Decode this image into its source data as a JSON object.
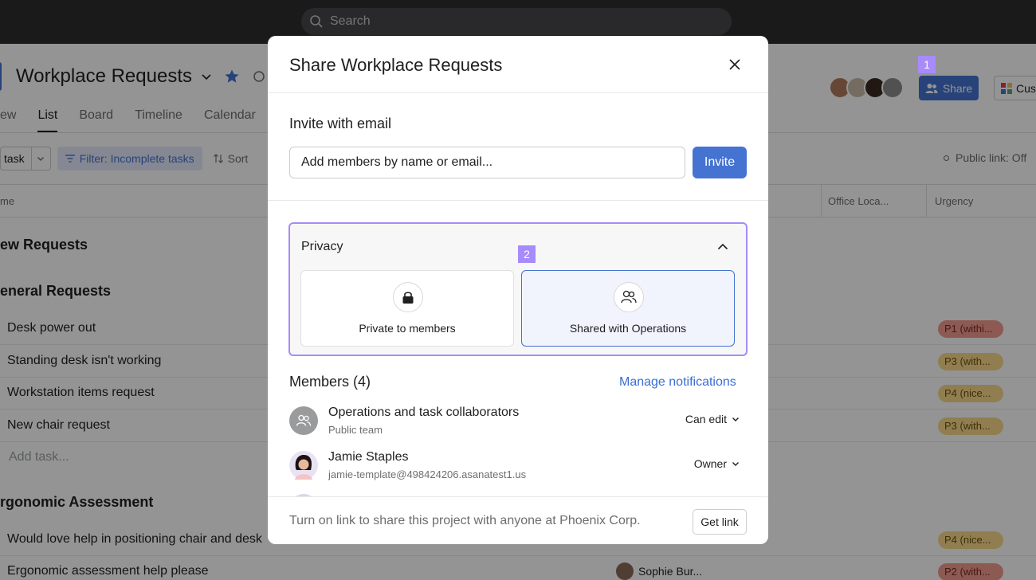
{
  "topbar": {
    "search_placeholder": "Search"
  },
  "project": {
    "title": "Workplace Requests",
    "tabs": [
      "ew",
      "List",
      "Board",
      "Timeline",
      "Calendar"
    ],
    "active_tab": "List"
  },
  "toolbar": {
    "add_task": "task",
    "filter": "Filter: Incomplete tasks",
    "sort": "Sort",
    "public_link": "Public link: Off"
  },
  "columns": {
    "name": "me",
    "office": "Office Loca...",
    "urgency": "Urgency"
  },
  "sections": {
    "new": "ew Requests",
    "general": "eneral Requests",
    "ergonomic": "rgonomic Assessment"
  },
  "tasks": [
    {
      "name": "Desk power out",
      "urgency": "P1 (withi..."
    },
    {
      "name": "Standing desk isn't working",
      "urgency": "P3 (with..."
    },
    {
      "name": "Workstation items request",
      "urgency": "P4 (nice..."
    },
    {
      "name": "New chair request",
      "urgency": "P3 (with..."
    }
  ],
  "add_task_text": "Add task...",
  "ergo_tasks": [
    {
      "name": "Would love help in positioning chair and desk",
      "urgency": "P4 (nice..."
    },
    {
      "name": "Ergonomic assessment help please",
      "urgency": "P2 (with...",
      "assignee": "Sophie Bur..."
    }
  ],
  "header_actions": {
    "share": "Share",
    "customize": "Cus"
  },
  "markers": {
    "m1": "1",
    "m2": "2"
  },
  "modal": {
    "title": "Share Workplace Requests",
    "invite_label": "Invite with email",
    "invite_placeholder": "Add members by name or email...",
    "invite_button": "Invite",
    "privacy": {
      "title": "Privacy",
      "private_label": "Private to members",
      "shared_label": "Shared with Operations",
      "selected": "shared"
    },
    "members_title": "Members (4)",
    "manage_notifications": "Manage notifications",
    "members": [
      {
        "name": "Operations and task collaborators",
        "sub": "Public team",
        "role": "Can edit"
      },
      {
        "name": "Jamie Staples",
        "sub": "jamie-template@498424206.asanatest1.us",
        "role": "Owner"
      }
    ],
    "footer_text": "Turn on link to share this project with anyone at Phoenix Corp.",
    "get_link": "Get link"
  },
  "colors": {
    "accent": "#4573d2",
    "highlight": "#a78bfa"
  }
}
